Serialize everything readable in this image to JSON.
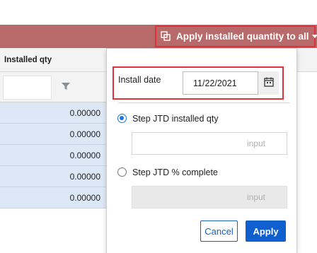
{
  "toolbar": {
    "apply_all_label": "Apply installed quantity to all"
  },
  "grid": {
    "column_header": "Installed qty",
    "rows": [
      "0.00000",
      "0.00000",
      "0.00000",
      "0.00000",
      "0.00000"
    ]
  },
  "popover": {
    "install_date_label": "Install date",
    "install_date_value": "11/22/2021",
    "option_jtd_qty_label": "Step JTD installed qty",
    "option_jtd_qty_selected": true,
    "option_jtd_qty_placeholder": "input",
    "option_jtd_pct_label": "Step JTD % complete",
    "option_jtd_pct_selected": false,
    "option_jtd_pct_placeholder": "input",
    "cancel_label": "Cancel",
    "apply_label": "Apply"
  },
  "colors": {
    "header_bar": "#b86a6a",
    "highlight_border": "#e0323a",
    "row_selected": "#dde8f6",
    "primary": "#0f5fce"
  }
}
